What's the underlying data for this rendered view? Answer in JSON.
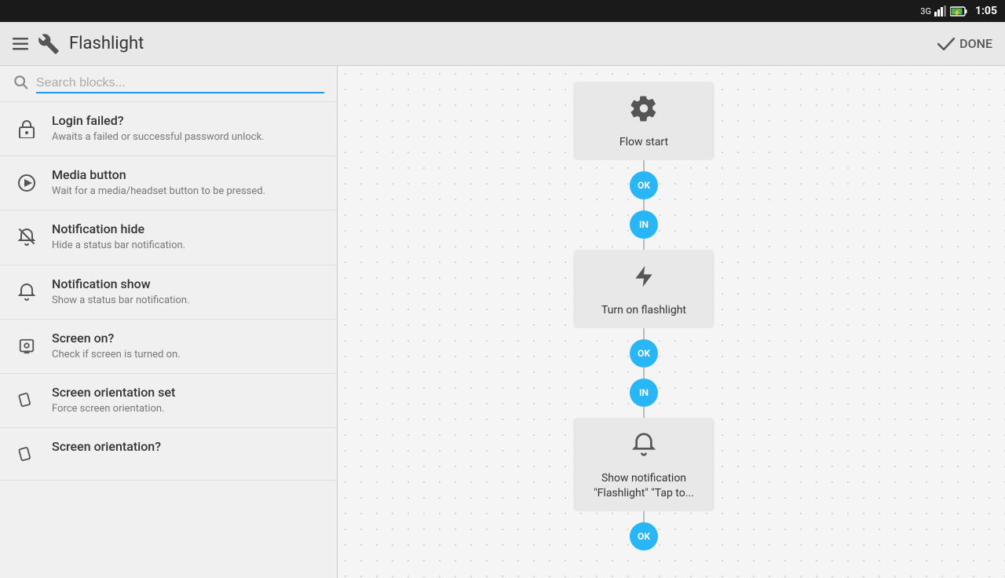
{
  "statusBar": {
    "signal": "3G",
    "battery": "⚡",
    "time": "1:05"
  },
  "header": {
    "icon": "wrench",
    "title": "Flashlight",
    "doneLabel": "DONE"
  },
  "search": {
    "placeholder": "Search blocks..."
  },
  "sidebarItems": [
    {
      "id": "login-failed",
      "title": "Login failed?",
      "desc": "Awaits a failed or successful password unlock.",
      "icon": "lock"
    },
    {
      "id": "media-button",
      "title": "Media button",
      "desc": "Wait for a media/headset button to be pressed.",
      "icon": "play"
    },
    {
      "id": "notification-hide",
      "title": "Notification hide",
      "desc": "Hide a status bar notification.",
      "icon": "bell-slash"
    },
    {
      "id": "notification-show",
      "title": "Notification show",
      "desc": "Show a status bar notification.",
      "icon": "bell"
    },
    {
      "id": "screen-on",
      "title": "Screen on?",
      "desc": "Check if screen is turned on.",
      "icon": "screen"
    },
    {
      "id": "screen-orientation-set",
      "title": "Screen orientation set",
      "desc": "Force screen orientation.",
      "icon": "orient"
    },
    {
      "id": "screen-orientation",
      "title": "Screen orientation?",
      "desc": "",
      "icon": "orient2"
    }
  ],
  "flowNodes": [
    {
      "id": "flow-start",
      "label": "Flow start",
      "icon": "gear",
      "connectorBelow": "OK"
    },
    {
      "id": "turn-on-flashlight",
      "label": "Turn on flashlight",
      "icon": "flash",
      "connectorAbove": "IN",
      "connectorBelow": "OK"
    },
    {
      "id": "show-notification",
      "label": "Show notification\n\"Flashlight\" \"Tap to...",
      "icon": "bell",
      "connectorAbove": "IN",
      "connectorBelow": "OK"
    }
  ]
}
